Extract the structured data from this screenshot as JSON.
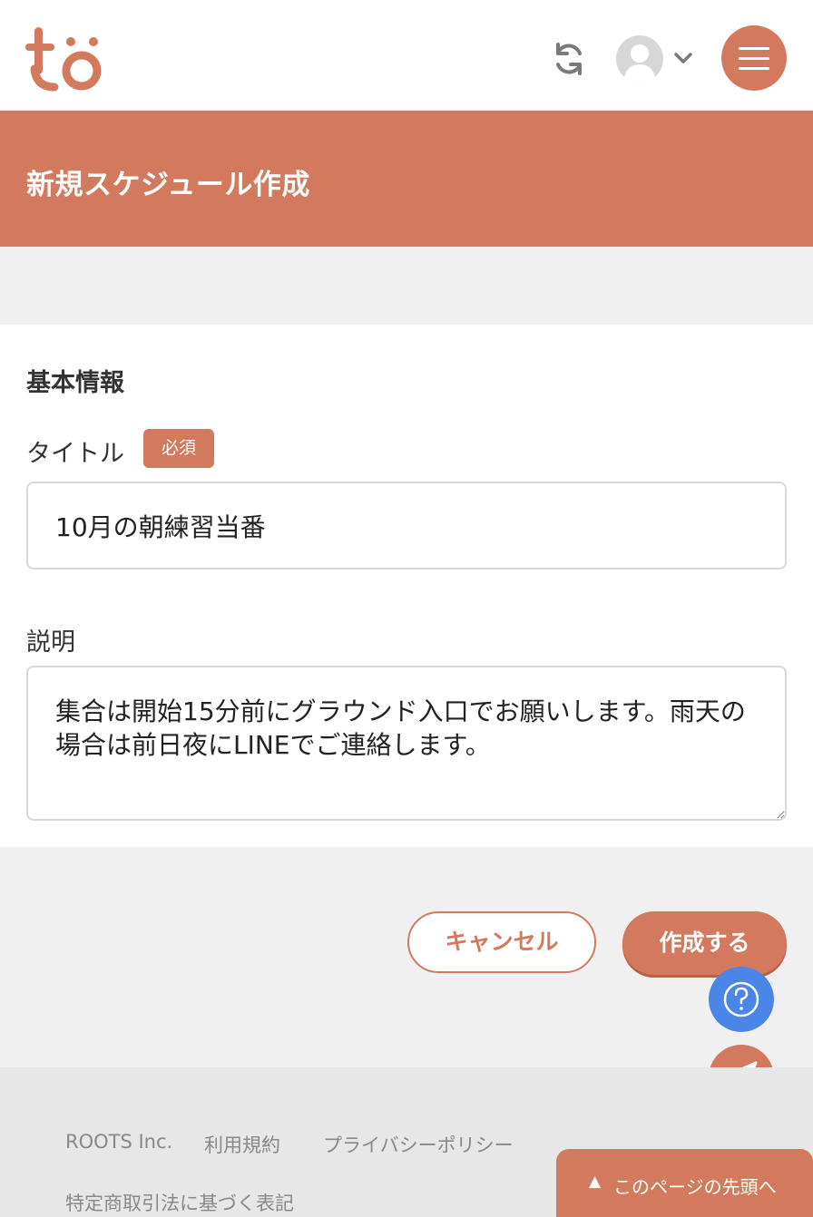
{
  "header": {
    "logo_text": "tö",
    "icons": {
      "sync": "sync-icon",
      "avatar": "user-avatar",
      "chevron": "chevron-down-icon",
      "menu": "hamburger-menu-icon"
    },
    "colors": {
      "brand": "#d3795d",
      "icon_gray": "#7a7a7a"
    }
  },
  "banner": {
    "title": "新規スケジュール作成"
  },
  "form": {
    "section_title": "基本情報",
    "title_field": {
      "label": "タイトル",
      "badge": "必須",
      "value": "10月の朝練習当番"
    },
    "description_field": {
      "label": "説明",
      "value": "集合は開始15分前にグラウンド入口でお願いします。雨天の場合は前日夜にLINEでご連絡します。"
    }
  },
  "actions": {
    "cancel_label": "キャンセル",
    "create_label": "作成する"
  },
  "floating": {
    "help_icon": "question-circle-icon",
    "send_icon": "paper-plane-icon",
    "help_color": "#4a86e8"
  },
  "footer": {
    "links": [
      "ROOTS Inc.",
      "利用規約",
      "プライバシーポリシー",
      "特定商取引法に基づく表記"
    ],
    "top_button": {
      "arrow": "▲",
      "label": "このページの先頭へ"
    }
  }
}
